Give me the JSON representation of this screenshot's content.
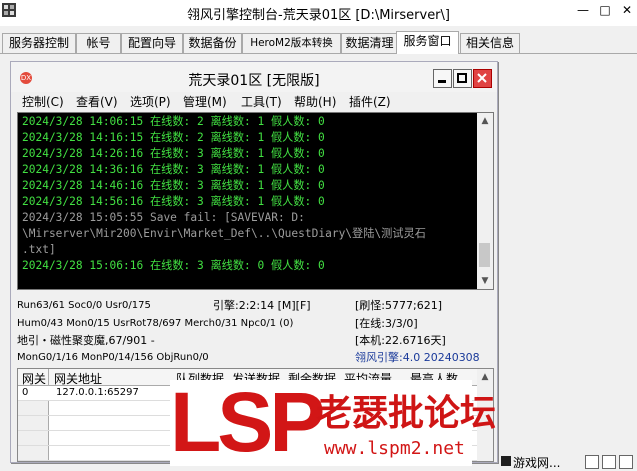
{
  "window": {
    "title": "翎风引擎控制台-荒天录01区 [D:\\Mirserver\\]",
    "min": "—",
    "max": "□",
    "close": "✕"
  },
  "tabs": [
    "服务器控制",
    "帐号",
    "配置向导",
    "数据备份",
    "HeroM2版本转换",
    "数据清理",
    "服务窗口",
    "相关信息"
  ],
  "child": {
    "title": "荒天录01区 [无限版]",
    "menus": [
      "控制(C)",
      "查看(V)",
      "选项(P)",
      "管理(M)",
      "工具(T)",
      "帮助(H)",
      "插件(Z)"
    ]
  },
  "console": {
    "lines": [
      "2024/3/28 14:06:15 在线数: 2 离线数: 1 假人数: 0",
      "2024/3/28 14:16:15 在线数: 2 离线数: 1 假人数: 0",
      "2024/3/28 14:26:16 在线数: 3 离线数: 1 假人数: 0",
      "2024/3/28 14:36:16 在线数: 3 离线数: 1 假人数: 0",
      "2024/3/28 14:46:16 在线数: 3 离线数: 1 假人数: 0",
      "2024/3/28 14:56:16 在线数: 3 离线数: 1 假人数: 0",
      "2024/3/28 15:05:55 Save fail: [SAVEVAR: D:",
      "\\Mirserver\\Mir200\\Envir\\Market_Def\\..\\QuestDiary\\登陆\\测试灵石",
      ".txt]",
      "2024/3/28 15:06:16 在线数: 3 离线数: 0 假人数: 0"
    ]
  },
  "stats": {
    "run": "Run63/61 Soc0/0 Usr0/175",
    "engine": "引擎:2:2:14 [M][F]",
    "refresh": "[刷怪:5777;621]",
    "hum": "Hum0/43 Mon0/15 UsrRot78/697 Merch0/31 Npc0/1 (0)",
    "online": "[在线:3/3/0]",
    "map": "地引・磁性聚变魔,67/901 -",
    "local": "[本机:22.6716天]",
    "mong": "MonG0/1/16 MonP0/14/156 ObjRun0/0",
    "version": "翎风引擎:4.0 20240308"
  },
  "grid": {
    "headers": [
      "网关",
      "网关地址",
      "队列数据",
      "发送数据",
      "剩余数据",
      "平均流量",
      "最高人数"
    ],
    "rows": [
      {
        "id": "0",
        "address": "127.0.0.1:65297"
      }
    ]
  },
  "watermark": {
    "brand": "LSP",
    "cn": "老瑟批论坛",
    "url": "www.lspm2.net"
  },
  "taskbar": {
    "label": "游戏网..."
  },
  "colors": {
    "console_text": "#42e042",
    "console_bg": "#000000",
    "watermark": "#d21616",
    "version_text": "#1a3a9a"
  }
}
